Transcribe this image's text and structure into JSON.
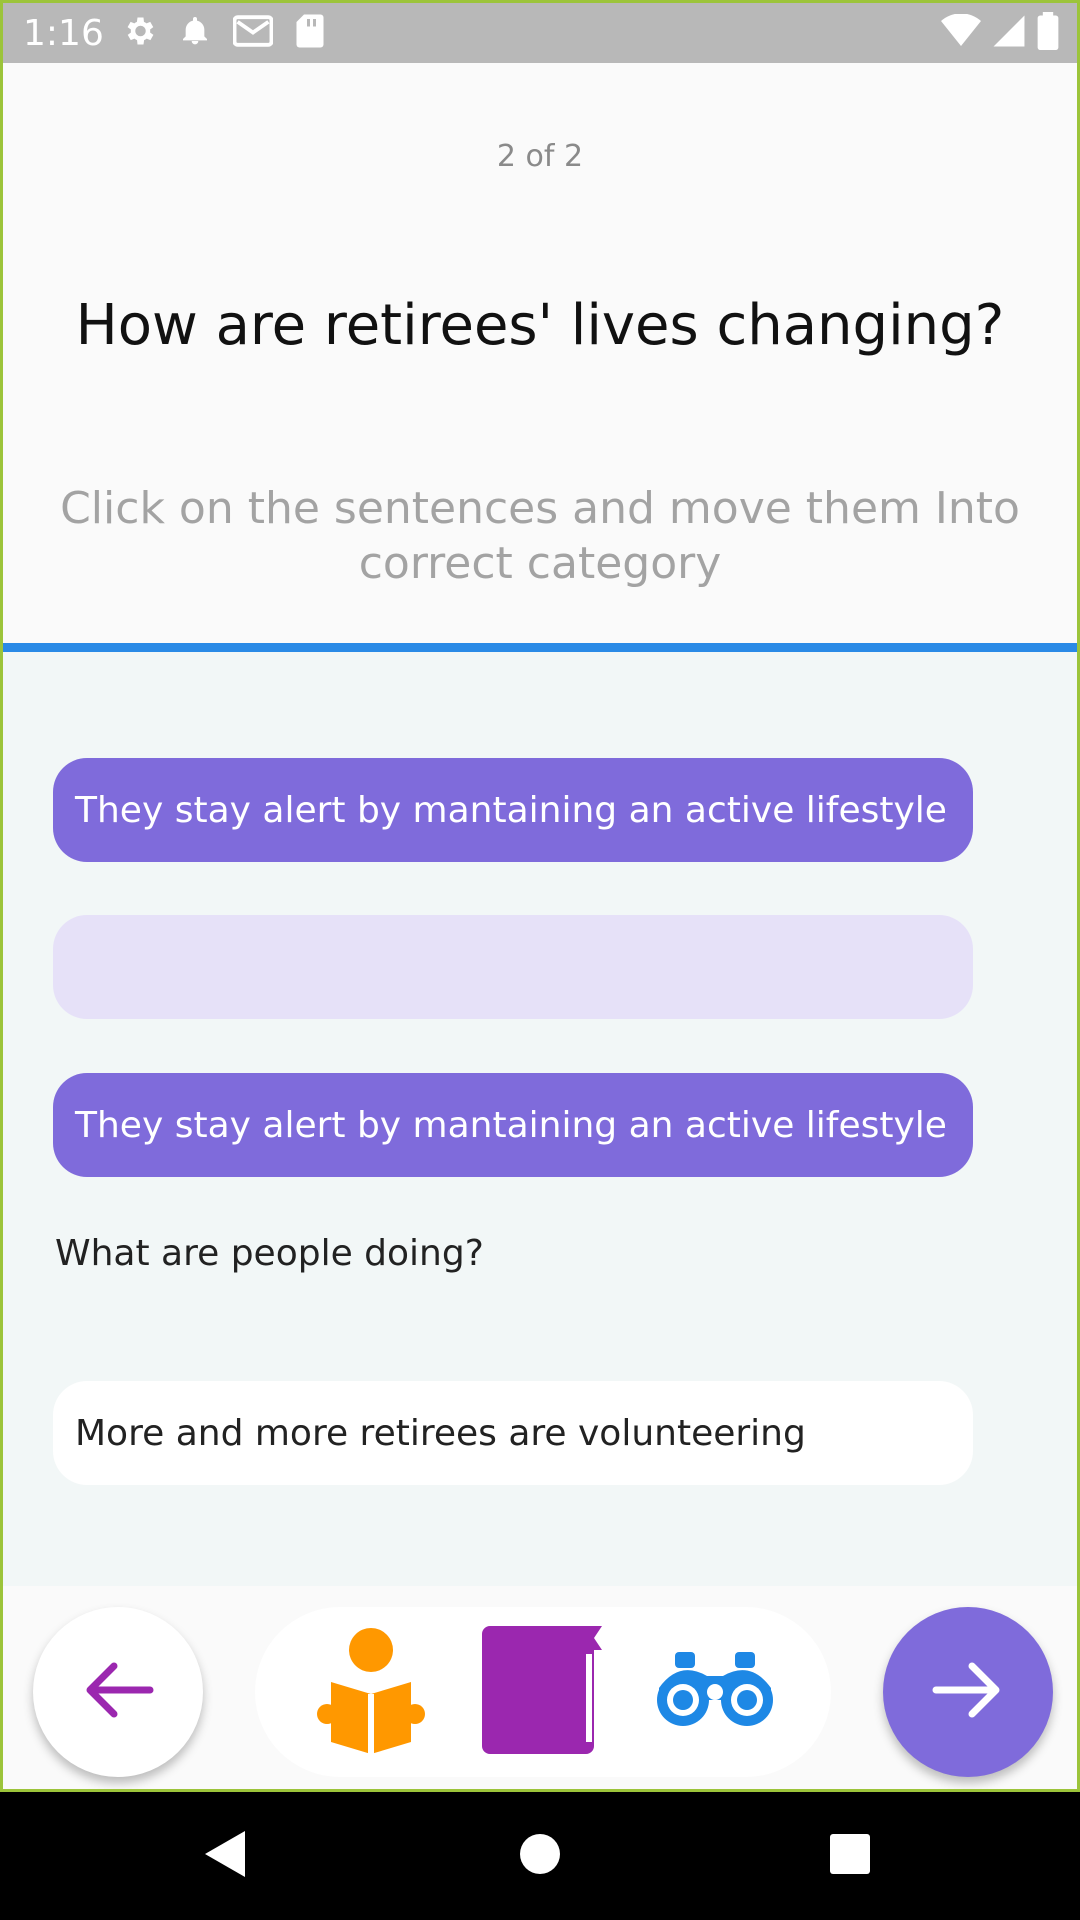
{
  "status_bar": {
    "time": "1:16",
    "left_icons": [
      "gear-icon",
      "bell-icon",
      "mail-icon",
      "sd-card-icon"
    ],
    "right_icons": [
      "wifi-icon",
      "signal-icon",
      "battery-icon"
    ]
  },
  "header": {
    "counter": "2 of 2",
    "title": "How are retirees' lives changing?",
    "instruction": "Click on the sentences and move them Into correct category"
  },
  "colors": {
    "accent": "#7f6bdb",
    "accent_light": "#e6e1f8",
    "divider": "#2a8ae6",
    "back_arrow": "#9b27af",
    "reader_icon": "#ff9800",
    "book_icon": "#9b27af",
    "binoculars_icon": "#1e88e5"
  },
  "slots": [
    {
      "text": "They stay alert by mantaining an active lifestyle",
      "state": "filled"
    },
    {
      "text": "",
      "state": "empty"
    },
    {
      "text": "They stay alert by mantaining an active lifestyle",
      "state": "filled"
    }
  ],
  "category": {
    "label": "What are people doing?"
  },
  "options": [
    {
      "text": "More and more retirees are volunteering"
    }
  ],
  "bottom_nav": {
    "back_icon": "arrow-left-icon",
    "next_icon": "arrow-right-icon",
    "tools": [
      "reader-icon",
      "book-icon",
      "binoculars-icon"
    ]
  },
  "system_nav": [
    "back-triangle-icon",
    "home-circle-icon",
    "recents-square-icon"
  ]
}
